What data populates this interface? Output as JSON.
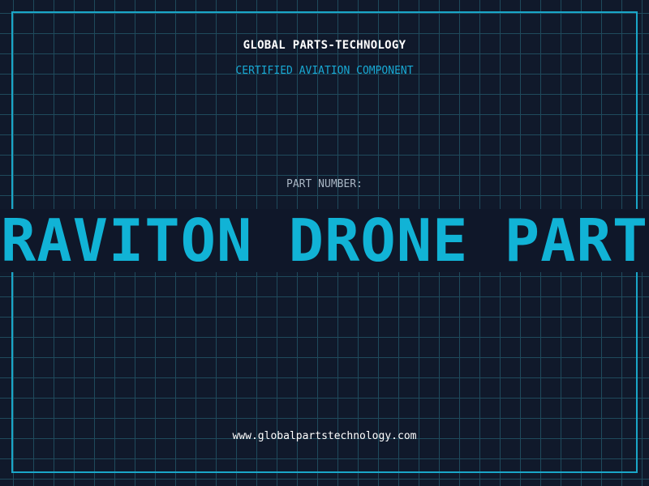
{
  "header": {
    "company": "GLOBAL PARTS-TECHNOLOGY",
    "subtitle": "CERTIFIED AVIATION COMPONENT"
  },
  "part": {
    "label": "PART NUMBER:",
    "name": "GRAVITON DRONE PARTS"
  },
  "footer": {
    "url": "www.globalpartstechnology.com"
  },
  "colors": {
    "background": "#10192b",
    "grid": "#1f4a5c",
    "accent": "#11b3d6",
    "border": "#1aa6c8",
    "text": "#ffffff",
    "muted": "#a9b6c4"
  }
}
